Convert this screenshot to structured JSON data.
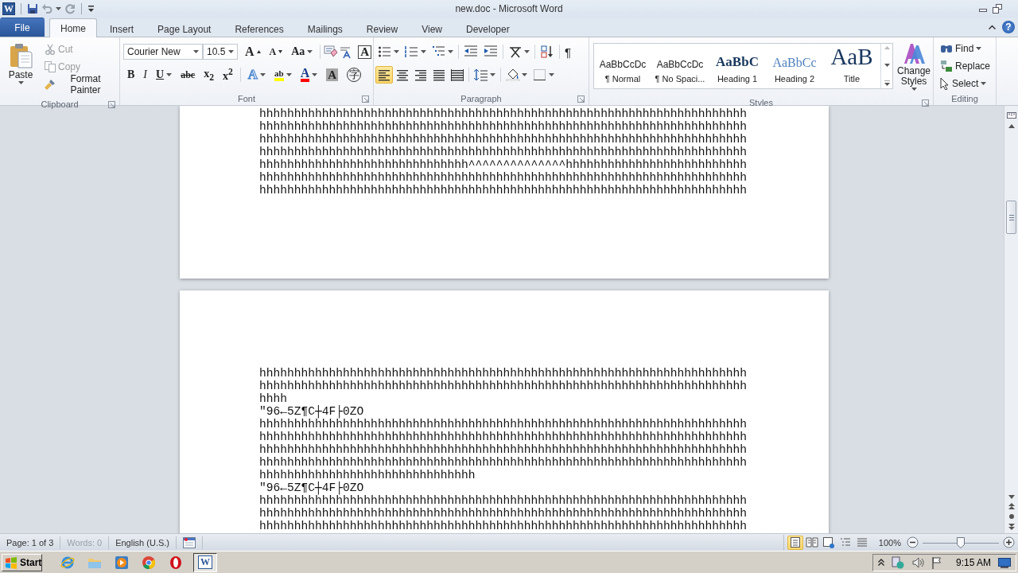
{
  "window": {
    "app_icon": "W",
    "title": "new.doc - Microsoft Word",
    "help": "?"
  },
  "tabs": [
    {
      "label": "File",
      "kind": "file",
      "selected": false
    },
    {
      "label": "Home",
      "kind": "tab",
      "selected": true
    },
    {
      "label": "Insert",
      "kind": "tab",
      "selected": false
    },
    {
      "label": "Page Layout",
      "kind": "tab",
      "selected": false
    },
    {
      "label": "References",
      "kind": "tab",
      "selected": false
    },
    {
      "label": "Mailings",
      "kind": "tab",
      "selected": false
    },
    {
      "label": "Review",
      "kind": "tab",
      "selected": false
    },
    {
      "label": "View",
      "kind": "tab",
      "selected": false
    },
    {
      "label": "Developer",
      "kind": "tab",
      "selected": false
    }
  ],
  "ribbon": {
    "clipboard": {
      "label": "Clipboard",
      "paste": "Paste",
      "cut": {
        "label": "Cut",
        "disabled": true
      },
      "copy": {
        "label": "Copy",
        "disabled": true
      },
      "format_painter": {
        "label": "Format Painter",
        "disabled": false
      }
    },
    "font": {
      "label": "Font",
      "name": "Courier New",
      "size": "10.5",
      "buttons": [
        {
          "kind": "grow",
          "label": "A"
        },
        {
          "kind": "shrink",
          "label": "A"
        },
        {
          "kind": "case",
          "label": "Aa"
        },
        {
          "kind": "border",
          "label": "A"
        },
        {
          "kind": "bold",
          "label": "B"
        },
        {
          "kind": "italic",
          "label": "I"
        },
        {
          "kind": "underline",
          "label": "U"
        },
        {
          "kind": "strike",
          "label": "abc"
        },
        {
          "kind": "sub",
          "label": "x$_{2}$"
        },
        {
          "kind": "sup",
          "label": "x$^{2}$"
        },
        {
          "kind": "effects",
          "label": "A"
        },
        {
          "kind": "highlight",
          "label": "ab"
        },
        {
          "kind": "color",
          "label": "A"
        },
        {
          "kind": "shading",
          "label": "A"
        },
        {
          "kind": "enclosed",
          "label": "字"
        }
      ]
    },
    "paragraph": {
      "label": "Paragraph",
      "pilcrow": "¶",
      "alignments": [
        {
          "kind": "left",
          "selected": true
        },
        {
          "kind": "center",
          "selected": false
        },
        {
          "kind": "right",
          "selected": false
        },
        {
          "kind": "justify",
          "selected": false
        },
        {
          "kind": "distributed",
          "selected": false
        }
      ]
    },
    "styles": {
      "label": "Styles",
      "change_styles": "Change Styles",
      "items": [
        {
          "kind": "normal",
          "preview": "AaBbCcDc",
          "name": "¶ Normal"
        },
        {
          "kind": "nospacing",
          "preview": "AaBbCcDc",
          "name": "¶ No Spaci..."
        },
        {
          "kind": "heading1",
          "preview": "AaBbC",
          "name": "Heading 1"
        },
        {
          "kind": "heading2",
          "preview": "AaBbCc",
          "name": "Heading 2"
        },
        {
          "kind": "title",
          "preview": "AaB",
          "name": "Title"
        }
      ]
    },
    "editing": {
      "label": "Editing",
      "find": "Find",
      "replace": "Replace",
      "select": "Select"
    }
  },
  "pages": [
    {
      "lines": [
        "hhhhhhhhhhhhhhhhhhhhhhhhhhhhhhhhhhhhhhhhhhhhhhhhhhhhhhhhhhhhhhhhhhhhhh",
        "hhhhhhhhhhhhhhhhhhhhhhhhhhhhhhhhhhhhhhhhhhhhhhhhhhhhhhhhhhhhhhhhhhhhhh",
        "hhhhhhhhhhhhhhhhhhhhhhhhhhhhhhhhhhhhhhhhhhhhhhhhhhhhhhhhhhhhhhhhhhhhhh",
        "hhhhhhhhhhhhhhhhhhhhhhhhhhhhhhhhhhhhhhhhhhhhhhhhhhhhhhhhhhhhhhhhhhhhhh",
        "hhhhhhhhhhhhhhhhhhhhhhhhhhhhhh^^^^^^^^^^^^^^hhhhhhhhhhhhhhhhhhhhhhhhhh",
        "hhhhhhhhhhhhhhhhhhhhhhhhhhhhhhhhhhhhhhhhhhhhhhhhhhhhhhhhhhhhhhhhhhhhhh",
        "hhhhhhhhhhhhhhhhhhhhhhhhhhhhhhhhhhhhhhhhhhhhhhhhhhhhhhhhhhhhhhhhhhhhhh"
      ]
    },
    {
      "lines": [
        "hhhhhhhhhhhhhhhhhhhhhhhhhhhhhhhhhhhhhhhhhhhhhhhhhhhhhhhhhhhhhhhhhhhhhh",
        "hhhhhhhhhhhhhhhhhhhhhhhhhhhhhhhhhhhhhhhhhhhhhhhhhhhhhhhhhhhhhhhhhhhhhh",
        "hhhh",
        "\"96←5Z¶C┼4F├0ZO",
        "hhhhhhhhhhhhhhhhhhhhhhhhhhhhhhhhhhhhhhhhhhhhhhhhhhhhhhhhhhhhhhhhhhhhhh",
        "hhhhhhhhhhhhhhhhhhhhhhhhhhhhhhhhhhhhhhhhhhhhhhhhhhhhhhhhhhhhhhhhhhhhhh",
        "hhhhhhhhhhhhhhhhhhhhhhhhhhhhhhhhhhhhhhhhhhhhhhhhhhhhhhhhhhhhhhhhhhhhhh",
        "hhhhhhhhhhhhhhhhhhhhhhhhhhhhhhhhhhhhhhhhhhhhhhhhhhhhhhhhhhhhhhhhhhhhhh",
        "hhhhhhhhhhhhhhhhhhhhhhhhhhhhhhh",
        "\"96←5Z¶C┼4F├0ZO",
        "hhhhhhhhhhhhhhhhhhhhhhhhhhhhhhhhhhhhhhhhhhhhhhhhhhhhhhhhhhhhhhhhhhhhhh",
        "hhhhhhhhhhhhhhhhhhhhhhhhhhhhhhhhhhhhhhhhhhhhhhhhhhhhhhhhhhhhhhhhhhhhhh",
        "hhhhhhhhhhhhhhhhhhhhhhhhhhhhhhhhhhhhhhhhhhhhhhhhhhhhhhhhhhhhhhhhhhhhhh"
      ]
    }
  ],
  "status_bar": {
    "page": "Page: 1 of 3",
    "words": {
      "label": "Words: 0",
      "disabled": true
    },
    "language": "English (U.S.)",
    "views": [
      {
        "kind": "print",
        "selected": true
      },
      {
        "kind": "reading",
        "selected": false
      },
      {
        "kind": "web",
        "selected": false
      },
      {
        "kind": "outline",
        "selected": false
      },
      {
        "kind": "draft",
        "selected": false
      }
    ],
    "zoom": "100%",
    "zoom_slider": {
      "level": 0.5
    }
  },
  "taskbar": {
    "start": "Start",
    "apps": [
      {
        "kind": "ie",
        "selected": false
      },
      {
        "kind": "explorer",
        "selected": false
      },
      {
        "kind": "media",
        "selected": false
      },
      {
        "kind": "chrome",
        "selected": false
      },
      {
        "kind": "opera",
        "selected": false
      },
      {
        "kind": "word",
        "label": "W",
        "selected": true
      }
    ],
    "clock": "9:15 AM"
  }
}
